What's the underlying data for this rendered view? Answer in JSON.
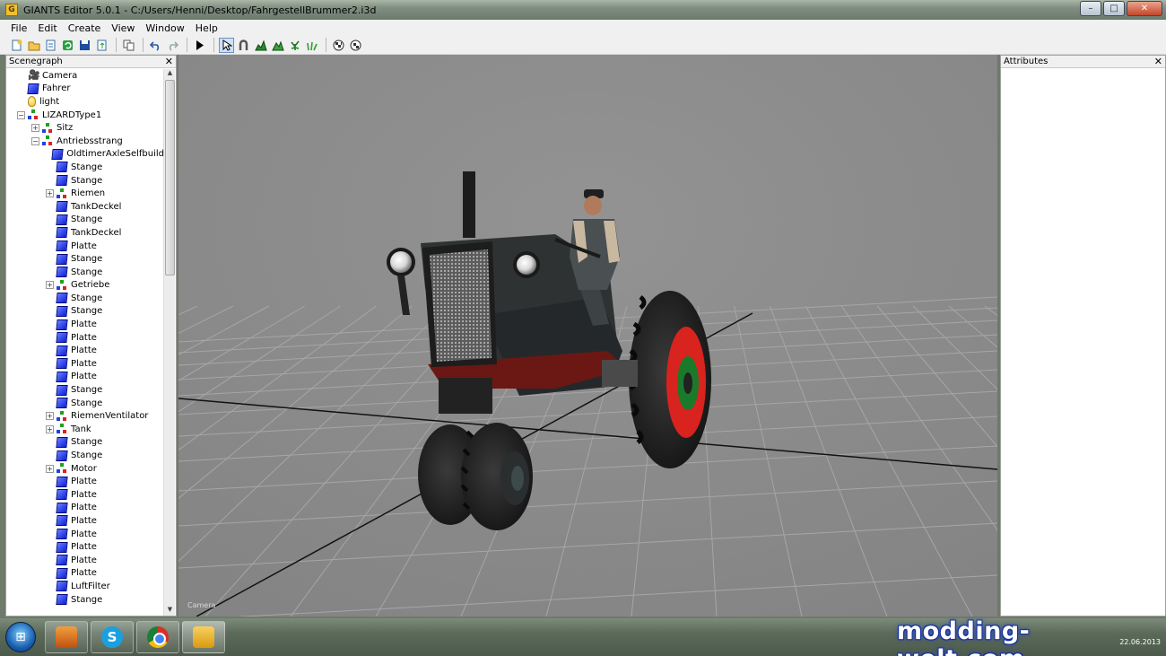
{
  "window": {
    "title": "GIANTS Editor 5.0.1 - C:/Users/Henni/Desktop/FahrgestellBrummer2.i3d",
    "controls": {
      "minimize": "–",
      "maximize": "□",
      "close": "✕"
    }
  },
  "menu": {
    "items": [
      "File",
      "Edit",
      "Create",
      "View",
      "Window",
      "Help"
    ]
  },
  "scenegraph": {
    "title": "Scenegraph",
    "close": "✕",
    "nodes": [
      {
        "label": "Camera",
        "icon": "camera-icon",
        "level": 0,
        "expander": ""
      },
      {
        "label": "Fahrer",
        "icon": "shape-icon",
        "level": 0,
        "expander": ""
      },
      {
        "label": "light",
        "icon": "light-icon",
        "level": 0,
        "expander": ""
      },
      {
        "label": "LIZARDType1",
        "icon": "transform-group-icon",
        "level": 0,
        "expander": "-"
      },
      {
        "label": "Sitz",
        "icon": "transform-group-icon",
        "level": 1,
        "expander": "+"
      },
      {
        "label": "Antriebsstrang",
        "icon": "transform-group-icon",
        "level": 1,
        "expander": "-"
      },
      {
        "label": "OldtimerAxleSelfbuild",
        "icon": "shape-icon",
        "level": 2,
        "expander": ""
      },
      {
        "label": "Stange",
        "icon": "shape-icon",
        "level": 2,
        "expander": ""
      },
      {
        "label": "Stange",
        "icon": "shape-icon",
        "level": 2,
        "expander": ""
      },
      {
        "label": "Riemen",
        "icon": "transform-group-icon",
        "level": 2,
        "expander": "+"
      },
      {
        "label": "TankDeckel",
        "icon": "shape-icon",
        "level": 2,
        "expander": ""
      },
      {
        "label": "Stange",
        "icon": "shape-icon",
        "level": 2,
        "expander": ""
      },
      {
        "label": "TankDeckel",
        "icon": "shape-icon",
        "level": 2,
        "expander": ""
      },
      {
        "label": "Platte",
        "icon": "shape-icon",
        "level": 2,
        "expander": ""
      },
      {
        "label": "Stange",
        "icon": "shape-icon",
        "level": 2,
        "expander": ""
      },
      {
        "label": "Stange",
        "icon": "shape-icon",
        "level": 2,
        "expander": ""
      },
      {
        "label": "Getriebe",
        "icon": "transform-group-icon",
        "level": 2,
        "expander": "+"
      },
      {
        "label": "Stange",
        "icon": "shape-icon",
        "level": 2,
        "expander": ""
      },
      {
        "label": "Stange",
        "icon": "shape-icon",
        "level": 2,
        "expander": ""
      },
      {
        "label": "Platte",
        "icon": "shape-icon",
        "level": 2,
        "expander": ""
      },
      {
        "label": "Platte",
        "icon": "shape-icon",
        "level": 2,
        "expander": ""
      },
      {
        "label": "Platte",
        "icon": "shape-icon",
        "level": 2,
        "expander": ""
      },
      {
        "label": "Platte",
        "icon": "shape-icon",
        "level": 2,
        "expander": ""
      },
      {
        "label": "Platte",
        "icon": "shape-icon",
        "level": 2,
        "expander": ""
      },
      {
        "label": "Stange",
        "icon": "shape-icon",
        "level": 2,
        "expander": ""
      },
      {
        "label": "Stange",
        "icon": "shape-icon",
        "level": 2,
        "expander": ""
      },
      {
        "label": "RiemenVentilator",
        "icon": "transform-group-icon",
        "level": 2,
        "expander": "+"
      },
      {
        "label": "Tank",
        "icon": "transform-group-icon",
        "level": 2,
        "expander": "+"
      },
      {
        "label": "Stange",
        "icon": "shape-icon",
        "level": 2,
        "expander": ""
      },
      {
        "label": "Stange",
        "icon": "shape-icon",
        "level": 2,
        "expander": ""
      },
      {
        "label": "Motor",
        "icon": "transform-group-icon",
        "level": 2,
        "expander": "+"
      },
      {
        "label": "Platte",
        "icon": "shape-icon",
        "level": 2,
        "expander": ""
      },
      {
        "label": "Platte",
        "icon": "shape-icon",
        "level": 2,
        "expander": ""
      },
      {
        "label": "Platte",
        "icon": "shape-icon",
        "level": 2,
        "expander": ""
      },
      {
        "label": "Platte",
        "icon": "shape-icon",
        "level": 2,
        "expander": ""
      },
      {
        "label": "Platte",
        "icon": "shape-icon",
        "level": 2,
        "expander": ""
      },
      {
        "label": "Platte",
        "icon": "shape-icon",
        "level": 2,
        "expander": ""
      },
      {
        "label": "Platte",
        "icon": "shape-icon",
        "level": 2,
        "expander": ""
      },
      {
        "label": "Platte",
        "icon": "shape-icon",
        "level": 2,
        "expander": ""
      },
      {
        "label": "LuftFilter",
        "icon": "shape-icon",
        "level": 2,
        "expander": ""
      },
      {
        "label": "Stange",
        "icon": "shape-icon",
        "level": 2,
        "expander": ""
      }
    ]
  },
  "attributes": {
    "title": "Attributes",
    "close": "✕"
  },
  "viewport": {
    "camera_label": "Camera"
  },
  "taskbar": {
    "apps": [
      "media-player-icon",
      "skype-icon",
      "chrome-icon",
      "giants-editor-icon"
    ],
    "date": "22.06.2013"
  },
  "watermark": {
    "text": "modding-welt.com"
  },
  "colors": {
    "viewport_bg": "#8b8b8b",
    "tractor_body": "#2f3233",
    "wheel_rim": "#d8231e",
    "frame_red": "#6b1815"
  }
}
